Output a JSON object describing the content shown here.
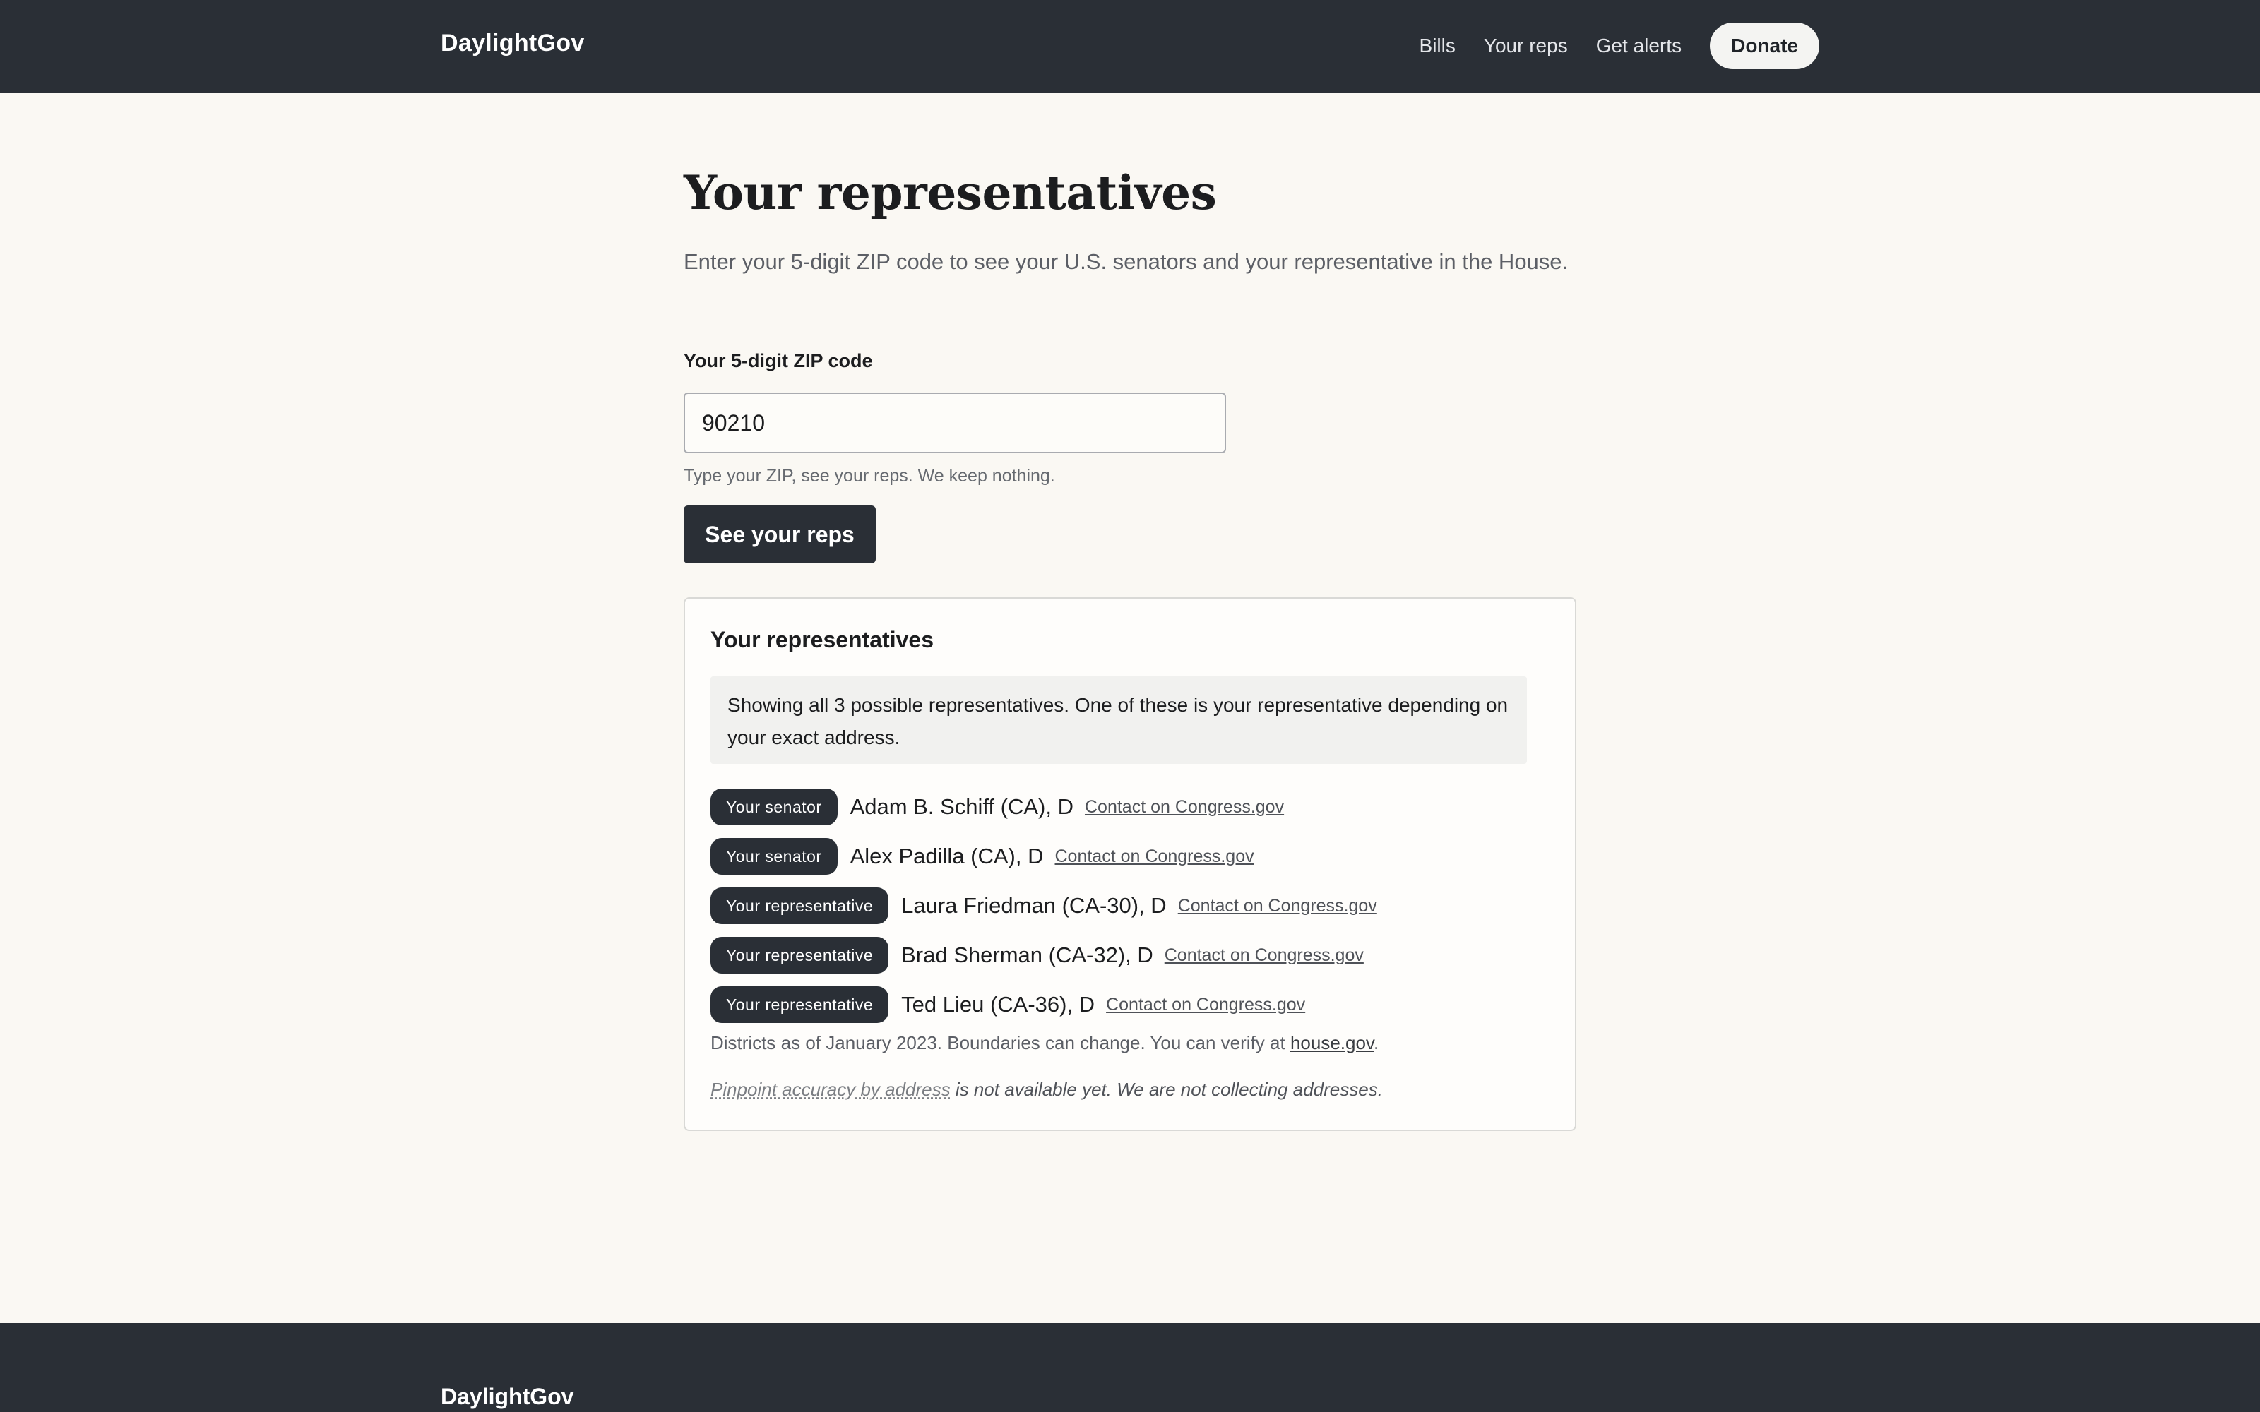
{
  "header": {
    "brand": "DaylightGov",
    "nav": [
      "Bills",
      "Your reps",
      "Get alerts"
    ],
    "donate_label": "Donate"
  },
  "main": {
    "title": "Your representatives",
    "intro": "Enter your 5-digit ZIP code to see your U.S. senators and your representative in the House.",
    "zip_label": "Your 5-digit ZIP code",
    "zip_value": "90210",
    "zip_hint": "Type your ZIP, see your reps. We keep nothing.",
    "submit_label": "See your reps"
  },
  "results": {
    "title": "Your representatives",
    "notice": "Showing all 3 possible representatives. One of these is your representative depending on your exact address.",
    "reps": [
      {
        "role": "Your senator",
        "name": "Adam B. Schiff (CA), D",
        "link": "Contact on Congress.gov"
      },
      {
        "role": "Your senator",
        "name": "Alex Padilla (CA), D",
        "link": "Contact on Congress.gov"
      },
      {
        "role": "Your representative",
        "name": "Laura Friedman (CA-30), D",
        "link": "Contact on Congress.gov"
      },
      {
        "role": "Your representative",
        "name": "Brad Sherman (CA-32), D",
        "link": "Contact on Congress.gov"
      },
      {
        "role": "Your representative",
        "name": "Ted Lieu (CA-36), D",
        "link": "Contact on Congress.gov"
      }
    ],
    "district_note_prefix": "Districts as of January 2023. Boundaries can change. You can verify at ",
    "district_note_link": "house.gov",
    "district_note_suffix": ".",
    "accuracy_term": "Pinpoint accuracy by address",
    "accuracy_rest": " is not available yet. We are not collecting addresses."
  },
  "footer": {
    "brand": "DaylightGov"
  }
}
